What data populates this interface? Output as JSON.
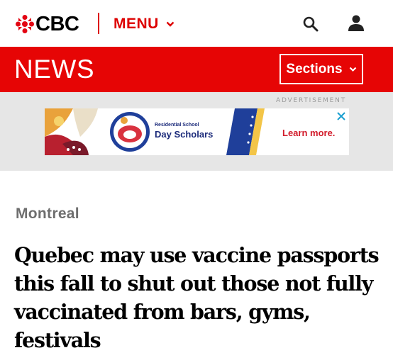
{
  "header": {
    "logo_text": "CBC",
    "menu_label": "MENU",
    "icons": {
      "logo": "cbc-gem-icon",
      "menu_chevron": "chevron-down-icon",
      "search": "search-icon",
      "account": "user-icon"
    }
  },
  "newsbar": {
    "title": "NEWS",
    "sections_label": "Sections",
    "color": "#e60505"
  },
  "ad": {
    "label": "ADVERTISEMENT",
    "subtitle": "Residential School",
    "title": "Day Scholars",
    "cta": "Learn more."
  },
  "article": {
    "kicker": "Montreal",
    "headline": "Quebec may use vaccine passports this fall to shut out those not fully vaccinated from bars, gyms, festivals"
  },
  "colors": {
    "brand_red": "#e60505",
    "menu_red": "#dd0000",
    "kicker_gray": "#6e6e6e"
  }
}
